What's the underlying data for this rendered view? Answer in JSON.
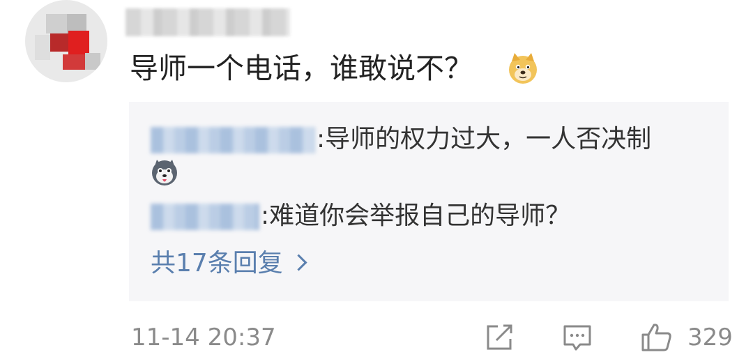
{
  "comment": {
    "avatar_icon": "pixelated-avatar-icon",
    "text": "导师一个电话，谁敢说不？",
    "emoji": "doge-emoji-icon"
  },
  "replies": [
    {
      "text": ":导师的权力过大，一人否决制",
      "emoji": "husky-emoji-icon"
    },
    {
      "text": ":难道你会举报自己的导师？"
    }
  ],
  "more_replies_label": "共17条回复",
  "timestamp": "11-14 20:37",
  "actions": {
    "repost_icon": "edit-share-icon",
    "comment_icon": "comment-bubble-icon",
    "like_icon": "thumbs-up-icon",
    "like_count": "329"
  },
  "colors": {
    "link": "#5a7fae",
    "meta": "#8a8a8a",
    "reply_bg": "#f6f6f8"
  }
}
